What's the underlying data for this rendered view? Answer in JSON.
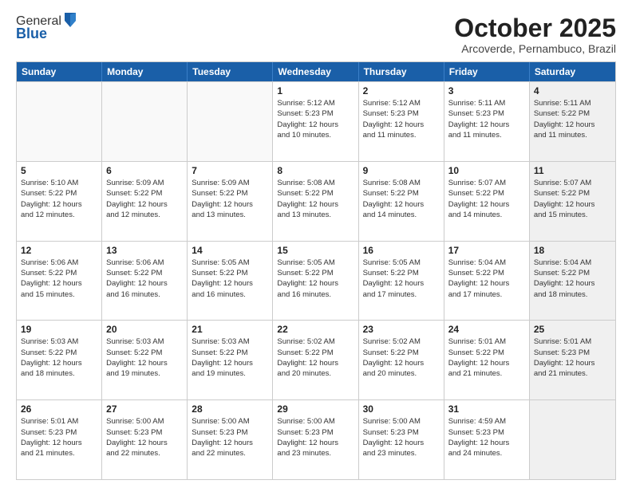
{
  "header": {
    "logo_line1": "General",
    "logo_line2": "Blue",
    "month_title": "October 2025",
    "location": "Arcoverde, Pernambuco, Brazil"
  },
  "weekdays": [
    "Sunday",
    "Monday",
    "Tuesday",
    "Wednesday",
    "Thursday",
    "Friday",
    "Saturday"
  ],
  "rows": [
    [
      {
        "day": "",
        "info": "",
        "empty": true
      },
      {
        "day": "",
        "info": "",
        "empty": true
      },
      {
        "day": "",
        "info": "",
        "empty": true
      },
      {
        "day": "1",
        "info": "Sunrise: 5:12 AM\nSunset: 5:23 PM\nDaylight: 12 hours\nand 10 minutes."
      },
      {
        "day": "2",
        "info": "Sunrise: 5:12 AM\nSunset: 5:23 PM\nDaylight: 12 hours\nand 11 minutes."
      },
      {
        "day": "3",
        "info": "Sunrise: 5:11 AM\nSunset: 5:23 PM\nDaylight: 12 hours\nand 11 minutes."
      },
      {
        "day": "4",
        "info": "Sunrise: 5:11 AM\nSunset: 5:22 PM\nDaylight: 12 hours\nand 11 minutes.",
        "shaded": true
      }
    ],
    [
      {
        "day": "5",
        "info": "Sunrise: 5:10 AM\nSunset: 5:22 PM\nDaylight: 12 hours\nand 12 minutes."
      },
      {
        "day": "6",
        "info": "Sunrise: 5:09 AM\nSunset: 5:22 PM\nDaylight: 12 hours\nand 12 minutes."
      },
      {
        "day": "7",
        "info": "Sunrise: 5:09 AM\nSunset: 5:22 PM\nDaylight: 12 hours\nand 13 minutes."
      },
      {
        "day": "8",
        "info": "Sunrise: 5:08 AM\nSunset: 5:22 PM\nDaylight: 12 hours\nand 13 minutes."
      },
      {
        "day": "9",
        "info": "Sunrise: 5:08 AM\nSunset: 5:22 PM\nDaylight: 12 hours\nand 14 minutes."
      },
      {
        "day": "10",
        "info": "Sunrise: 5:07 AM\nSunset: 5:22 PM\nDaylight: 12 hours\nand 14 minutes."
      },
      {
        "day": "11",
        "info": "Sunrise: 5:07 AM\nSunset: 5:22 PM\nDaylight: 12 hours\nand 15 minutes.",
        "shaded": true
      }
    ],
    [
      {
        "day": "12",
        "info": "Sunrise: 5:06 AM\nSunset: 5:22 PM\nDaylight: 12 hours\nand 15 minutes."
      },
      {
        "day": "13",
        "info": "Sunrise: 5:06 AM\nSunset: 5:22 PM\nDaylight: 12 hours\nand 16 minutes."
      },
      {
        "day": "14",
        "info": "Sunrise: 5:05 AM\nSunset: 5:22 PM\nDaylight: 12 hours\nand 16 minutes."
      },
      {
        "day": "15",
        "info": "Sunrise: 5:05 AM\nSunset: 5:22 PM\nDaylight: 12 hours\nand 16 minutes."
      },
      {
        "day": "16",
        "info": "Sunrise: 5:05 AM\nSunset: 5:22 PM\nDaylight: 12 hours\nand 17 minutes."
      },
      {
        "day": "17",
        "info": "Sunrise: 5:04 AM\nSunset: 5:22 PM\nDaylight: 12 hours\nand 17 minutes."
      },
      {
        "day": "18",
        "info": "Sunrise: 5:04 AM\nSunset: 5:22 PM\nDaylight: 12 hours\nand 18 minutes.",
        "shaded": true
      }
    ],
    [
      {
        "day": "19",
        "info": "Sunrise: 5:03 AM\nSunset: 5:22 PM\nDaylight: 12 hours\nand 18 minutes."
      },
      {
        "day": "20",
        "info": "Sunrise: 5:03 AM\nSunset: 5:22 PM\nDaylight: 12 hours\nand 19 minutes."
      },
      {
        "day": "21",
        "info": "Sunrise: 5:03 AM\nSunset: 5:22 PM\nDaylight: 12 hours\nand 19 minutes."
      },
      {
        "day": "22",
        "info": "Sunrise: 5:02 AM\nSunset: 5:22 PM\nDaylight: 12 hours\nand 20 minutes."
      },
      {
        "day": "23",
        "info": "Sunrise: 5:02 AM\nSunset: 5:22 PM\nDaylight: 12 hours\nand 20 minutes."
      },
      {
        "day": "24",
        "info": "Sunrise: 5:01 AM\nSunset: 5:22 PM\nDaylight: 12 hours\nand 21 minutes."
      },
      {
        "day": "25",
        "info": "Sunrise: 5:01 AM\nSunset: 5:23 PM\nDaylight: 12 hours\nand 21 minutes.",
        "shaded": true
      }
    ],
    [
      {
        "day": "26",
        "info": "Sunrise: 5:01 AM\nSunset: 5:23 PM\nDaylight: 12 hours\nand 21 minutes."
      },
      {
        "day": "27",
        "info": "Sunrise: 5:00 AM\nSunset: 5:23 PM\nDaylight: 12 hours\nand 22 minutes."
      },
      {
        "day": "28",
        "info": "Sunrise: 5:00 AM\nSunset: 5:23 PM\nDaylight: 12 hours\nand 22 minutes."
      },
      {
        "day": "29",
        "info": "Sunrise: 5:00 AM\nSunset: 5:23 PM\nDaylight: 12 hours\nand 23 minutes."
      },
      {
        "day": "30",
        "info": "Sunrise: 5:00 AM\nSunset: 5:23 PM\nDaylight: 12 hours\nand 23 minutes."
      },
      {
        "day": "31",
        "info": "Sunrise: 4:59 AM\nSunset: 5:23 PM\nDaylight: 12 hours\nand 24 minutes."
      },
      {
        "day": "",
        "info": "",
        "empty": true,
        "shaded": true
      }
    ]
  ]
}
